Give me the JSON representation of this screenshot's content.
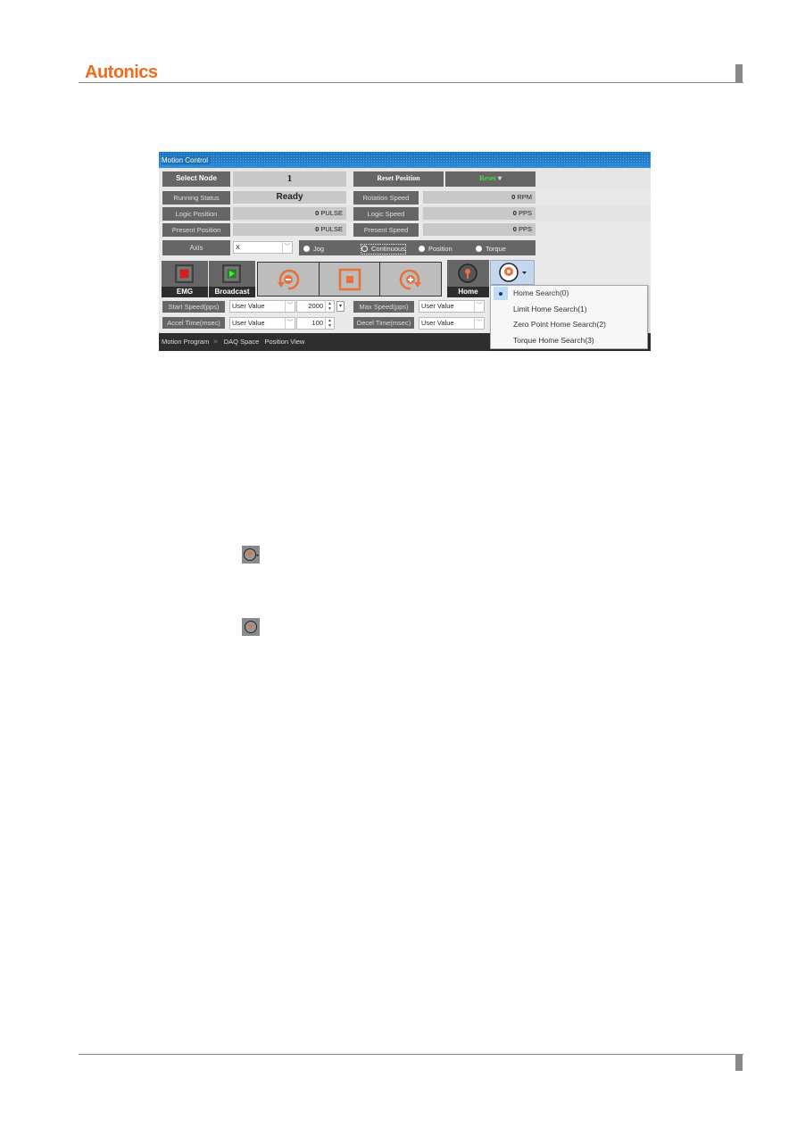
{
  "page_header": {
    "brand": "Autonics"
  },
  "window": {
    "title": "Motion Control",
    "select_node": {
      "label": "Select Node",
      "value": "1"
    },
    "reset_position_label": "Reset Position",
    "reset_label": "Reset",
    "running_status": {
      "label": "Running Status",
      "value": "Ready"
    },
    "rotation_speed": {
      "label": "Rotation Speed",
      "value": "0",
      "unit": "RPM"
    },
    "logic_position": {
      "label": "Logic Position",
      "value": "0",
      "unit": "PULSE"
    },
    "logic_speed": {
      "label": "Logic Speed",
      "value": "0",
      "unit": "PPS"
    },
    "present_position": {
      "label": "Present Position",
      "value": "0",
      "unit": "PULSE"
    },
    "present_speed": {
      "label": "Present Speed",
      "value": "0",
      "unit": "PPS"
    },
    "axis": {
      "label": "Axis",
      "value": "X"
    },
    "modes": [
      {
        "label": "Jog",
        "selected": false
      },
      {
        "label": "Continuous",
        "selected": true
      },
      {
        "label": "Position",
        "selected": false
      },
      {
        "label": "Torque",
        "selected": false
      }
    ],
    "emg_label": "EMG",
    "broadcast_label": "Broadcast",
    "home_label": "Home",
    "start_speed": {
      "label": "Start Speed(pps)",
      "mode": "User Value",
      "value": "2000"
    },
    "max_speed": {
      "label": "Max Speed(pps)",
      "mode": "User Value"
    },
    "accel_time": {
      "label": "Accel Time(msec)",
      "mode": "User Value",
      "value": "100"
    },
    "decel_time": {
      "label": "Decel Time(msec)",
      "mode": "User Value"
    },
    "tabs": [
      "Motion Program",
      "DAQ Space",
      "Position View"
    ],
    "home_menu": [
      {
        "label": "Home Search(0)",
        "checked": true
      },
      {
        "label": "Limit Home Search(1)",
        "checked": false
      },
      {
        "label": "Zero Point Home Search(2)",
        "checked": false
      },
      {
        "label": "Torque Home Search(3)",
        "checked": false
      }
    ]
  },
  "colors": {
    "brand": "#f26b1d",
    "accent_orange": "#e8703a",
    "green_text": "#3fdc3f",
    "title_blue": "#1c72b9"
  }
}
